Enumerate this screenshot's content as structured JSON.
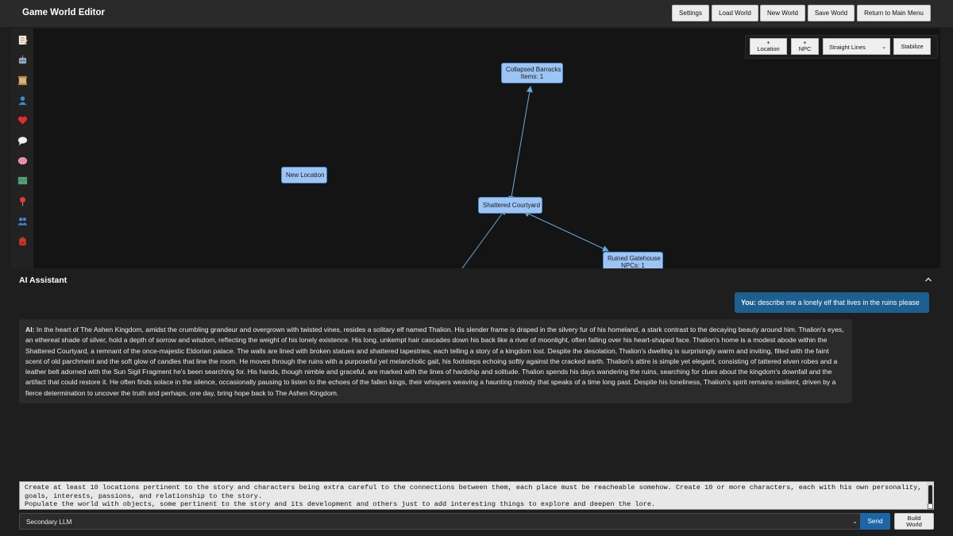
{
  "app": {
    "title": "Game World Editor"
  },
  "topbar": {
    "settings": "Settings",
    "load": "Load World",
    "new": "New World",
    "save": "Save World",
    "return": "Return to Main Menu"
  },
  "sidebar_icons": [
    "memo-icon",
    "robot-icon",
    "scroll-icon",
    "person-icon",
    "heart-icon",
    "speech-bubble-icon",
    "brain-icon",
    "map-icon",
    "pin-icon",
    "people-icon",
    "backpack-icon"
  ],
  "graph": {
    "toolbar": {
      "add_location": [
        "+",
        "Location"
      ],
      "add_npc": [
        "+",
        "NPC"
      ],
      "line_style": "Straight Lines",
      "stabilize": "Stabilize"
    },
    "nodes": {
      "barracks": [
        "Collapsed Barracks",
        "Items: 1"
      ],
      "new_location": [
        "New Location"
      ],
      "courtyard": [
        "Shattered Courtyard"
      ],
      "gatehouse": [
        "Ruined Gatehouse",
        "NPCs: 1"
      ]
    },
    "node_color": "#9cc5f5",
    "edge_color": "#6aaad8"
  },
  "assistant": {
    "title": "AI Assistant",
    "user_label": "You:",
    "user_message": "describe me a lonely elf that lives in the ruins please",
    "ai_label": "AI:",
    "ai_message": "In the heart of The Ashen Kingdom, amidst the crumbling grandeur and overgrown with twisted vines, resides a solitary elf named Thalion. His slender frame is draped in the silvery fur of his homeland, a stark contrast to the decaying beauty around him. Thalion's eyes, an ethereal shade of silver, hold a depth of sorrow and wisdom, reflecting the weight of his lonely existence. His long, unkempt hair cascades down his back like a river of moonlight, often falling over his heart-shaped face. Thalion's home is a modest abode within the Shattered Courtyard, a remnant of the once-majestic Eldorian palace. The walls are lined with broken statues and shattered tapestries, each telling a story of a kingdom lost. Despite the desolation, Thalion's dwelling is surprisingly warm and inviting, filled with the faint scent of old parchment and the soft glow of candles that line the room. He moves through the ruins with a purposeful yet melancholic gait, his footsteps echoing softly against the cracked earth. Thalion's attire is simple yet elegant, consisting of tattered elven robes and a leather belt adorned with the Sun Sigil Fragment he's been searching for. His hands, though nimble and graceful, are marked with the lines of hardship and solitude. Thalion spends his days wandering the ruins, searching for clues about the kingdom's downfall and the artifact that could restore it. He often finds solace in the silence, occasionally pausing to listen to the echoes of the fallen kings, their whispers weaving a haunting melody that speaks of a time long past. Despite his loneliness, Thalion's spirit remains resilient, driven by a fierce determination to uncover the truth and perhaps, one day, bring hope back to The Ashen Kingdom.",
    "prompt": "Create at least 10 locations pertinent to the story and characters being extra careful to the connections between them, each place must be reacheable somehow. Create 10 or more characters, each with his own personality, goals, interests, passions, and relationship to the story.\nPopulate the world with objects, some pertinent to the story and its development and others just to add interesting things to explore and deepen the lore.",
    "llm_select": "Secondary LLM",
    "send": "Send",
    "build": [
      "Build",
      "World"
    ]
  }
}
